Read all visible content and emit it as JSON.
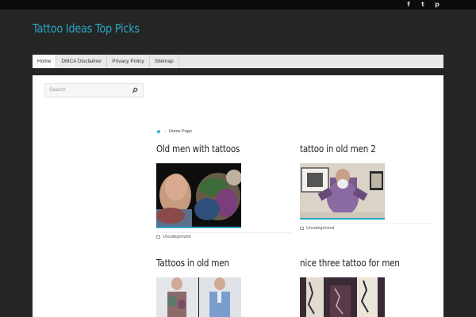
{
  "header": {
    "site_title": "Tattoo Ideas Top Picks",
    "social_icons": [
      "facebook-icon",
      "twitter-icon",
      "pinterest-icon"
    ],
    "social_glyphs": [
      "f",
      "t",
      "p"
    ]
  },
  "nav": {
    "items": [
      "Home",
      "DMCA Disclaimer",
      "Privacy Policy",
      "Sitemap"
    ]
  },
  "search": {
    "placeholder": "Search"
  },
  "breadcrumb": {
    "current": "Home Page"
  },
  "posts": [
    {
      "title": "Old men with tattoos",
      "category": "Uncategorized"
    },
    {
      "title": "tattoo in old men 2",
      "category": "Uncategorized"
    },
    {
      "title": "Tattoos in old men",
      "category": ""
    },
    {
      "title": "nice three tattoo for men",
      "category": ""
    }
  ],
  "colors": {
    "accent": "#2aa7c4",
    "background": "#252525",
    "topbar": "#0c0c0c"
  }
}
